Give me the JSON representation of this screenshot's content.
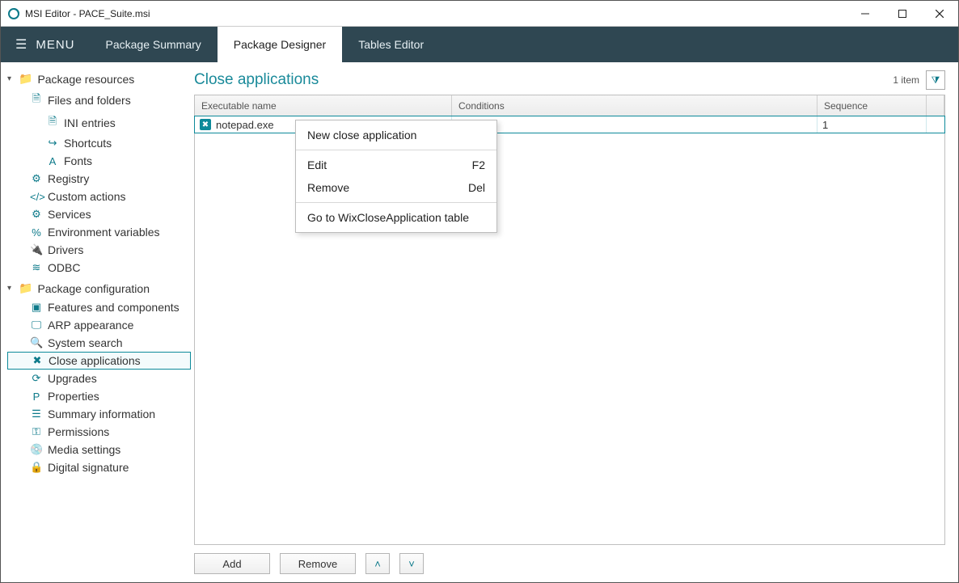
{
  "window": {
    "title": "MSI Editor - PACE_Suite.msi"
  },
  "menubar": {
    "menu_label": "MENU",
    "tabs": [
      {
        "label": "Package Summary",
        "active": false
      },
      {
        "label": "Package Designer",
        "active": true
      },
      {
        "label": "Tables Editor",
        "active": false
      }
    ]
  },
  "sidebar": {
    "groups": [
      {
        "label": "Package resources",
        "items": [
          {
            "label": "Files and folders",
            "icon": "file-icon",
            "sub": false
          },
          {
            "label": "INI entries",
            "icon": "ini-icon",
            "sub": true
          },
          {
            "label": "Shortcuts",
            "icon": "shortcut-icon",
            "sub": true
          },
          {
            "label": "Fonts",
            "icon": "font-icon",
            "sub": true
          },
          {
            "label": "Registry",
            "icon": "registry-icon",
            "sub": false
          },
          {
            "label": "Custom actions",
            "icon": "code-icon",
            "sub": false
          },
          {
            "label": "Services",
            "icon": "gear-icon",
            "sub": false
          },
          {
            "label": "Environment variables",
            "icon": "percent-icon",
            "sub": false
          },
          {
            "label": "Drivers",
            "icon": "plug-icon",
            "sub": false
          },
          {
            "label": "ODBC",
            "icon": "db-icon",
            "sub": false
          }
        ]
      },
      {
        "label": "Package configuration",
        "items": [
          {
            "label": "Features and components",
            "icon": "puzzle-icon",
            "sub": false
          },
          {
            "label": "ARP appearance",
            "icon": "monitor-icon",
            "sub": false
          },
          {
            "label": "System search",
            "icon": "search-icon",
            "sub": false
          },
          {
            "label": "Close applications",
            "icon": "close-app-icon",
            "sub": false,
            "selected": true
          },
          {
            "label": "Upgrades",
            "icon": "sync-icon",
            "sub": false
          },
          {
            "label": "Properties",
            "icon": "p-icon",
            "sub": false
          },
          {
            "label": "Summary information",
            "icon": "list-icon",
            "sub": false
          },
          {
            "label": "Permissions",
            "icon": "key-icon",
            "sub": false
          },
          {
            "label": "Media settings",
            "icon": "disc-icon",
            "sub": false
          },
          {
            "label": "Digital signature",
            "icon": "lock-icon",
            "sub": false
          }
        ]
      }
    ]
  },
  "main": {
    "title": "Close applications",
    "count_label": "1 item",
    "columns": {
      "exe": "Executable name",
      "cond": "Conditions",
      "seq": "Sequence"
    },
    "rows": [
      {
        "exe": "notepad.exe",
        "cond": "",
        "seq": "1"
      }
    ],
    "buttons": {
      "add": "Add",
      "remove": "Remove"
    }
  },
  "context_menu": {
    "items": [
      {
        "label": "New close application",
        "shortcut": ""
      },
      {
        "sep": true
      },
      {
        "label": "Edit",
        "shortcut": "F2"
      },
      {
        "label": "Remove",
        "shortcut": "Del"
      },
      {
        "sep": true
      },
      {
        "label": "Go to WixCloseApplication table",
        "shortcut": ""
      }
    ]
  },
  "icons": {
    "file-icon": "🗎",
    "ini-icon": "🗎",
    "shortcut-icon": "↪",
    "font-icon": "A",
    "registry-icon": "⚙",
    "code-icon": "</>",
    "gear-icon": "⚙",
    "percent-icon": "%",
    "plug-icon": "🔌",
    "db-icon": "≋",
    "puzzle-icon": "▣",
    "monitor-icon": "🖵",
    "search-icon": "🔍",
    "close-app-icon": "✖",
    "sync-icon": "⟳",
    "p-icon": "P",
    "list-icon": "☰",
    "key-icon": "⚿",
    "disc-icon": "💿",
    "lock-icon": "🔒"
  }
}
